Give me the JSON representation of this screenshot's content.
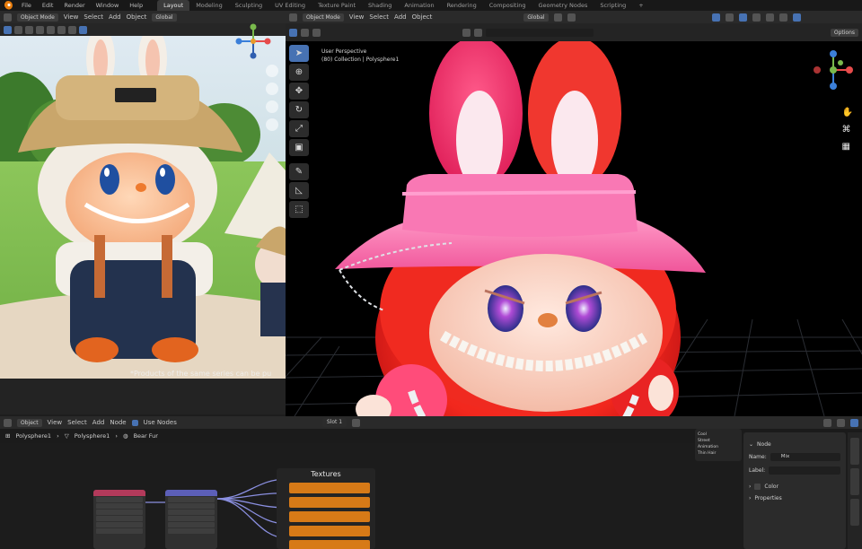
{
  "topbar": {
    "menus": [
      "File",
      "Edit",
      "Render",
      "Window",
      "Help"
    ],
    "workspaces": [
      "Layout",
      "Modeling",
      "Sculpting",
      "UV Editing",
      "Texture Paint",
      "Shading",
      "Animation",
      "Rendering",
      "Compositing",
      "Geometry Nodes",
      "Scripting"
    ],
    "active_workspace": "Layout"
  },
  "image_editor": {
    "mode": "Object Mode",
    "menus": [
      "View",
      "Select",
      "Add",
      "Object"
    ],
    "orientation": "Global",
    "caption": "*Products of the same series can be pu"
  },
  "viewport": {
    "mode": "Object Mode",
    "menus": [
      "View",
      "Select",
      "Add",
      "Object"
    ],
    "orientation": "Global",
    "options_label": "Options",
    "info_line1": "User Perspective",
    "info_line2": "(80) Collection | Polysphere1"
  },
  "shader_editor": {
    "mode": "Object",
    "menus": [
      "View",
      "Select",
      "Add",
      "Node"
    ],
    "use_nodes_label": "Use Nodes",
    "slot_label": "Slot 1",
    "breadcrumb": [
      "Polysphere1",
      "Polysphere1",
      "Bear Fur"
    ],
    "frame_title": "Textures",
    "outliner_items": [
      "Cool",
      "Street",
      "Animation",
      "Thin Hair"
    ],
    "n_panel": {
      "section_node": "Node",
      "name_label": "Name:",
      "name_value": "Mix",
      "label_label": "Label:",
      "color_label": "Color",
      "properties_label": "Properties"
    }
  },
  "colors": {
    "accent": "#4772b3",
    "texture_node": "#d77a17",
    "background": "#1d1d1d"
  }
}
